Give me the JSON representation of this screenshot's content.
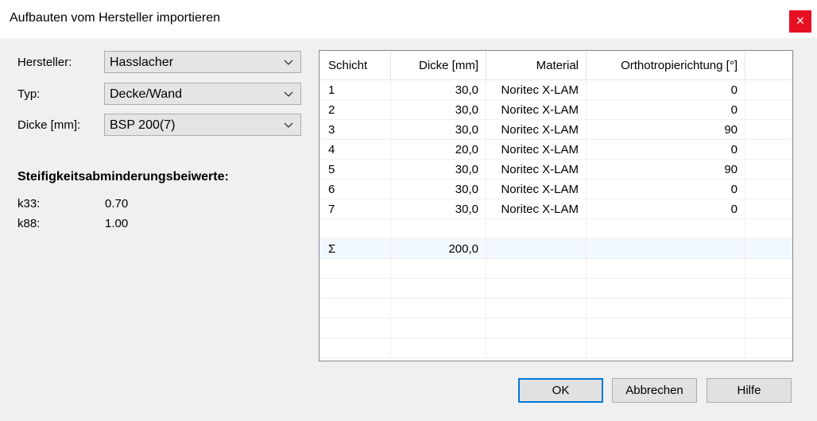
{
  "window": {
    "title": "Aufbauten vom Hersteller importieren",
    "close_glyph": "×"
  },
  "form": {
    "hersteller": {
      "label": "Hersteller:",
      "value": "Hasslacher"
    },
    "typ": {
      "label": "Typ:",
      "value": "Decke/Wand"
    },
    "dicke": {
      "label": "Dicke [mm]:",
      "value": "BSP 200(7)"
    }
  },
  "stiffness": {
    "title": "Steifigkeitsabminderungsbeiwerte:",
    "k33": {
      "label": "k33:",
      "value": "0.70"
    },
    "k88": {
      "label": "k88:",
      "value": "1.00"
    }
  },
  "table": {
    "headers": [
      "Schicht",
      "Dicke [mm]",
      "Material",
      "Orthotropierichtung [°]"
    ],
    "rows": [
      [
        "1",
        "30,0",
        "Noritec X-LAM",
        "0"
      ],
      [
        "2",
        "30,0",
        "Noritec X-LAM",
        "0"
      ],
      [
        "3",
        "30,0",
        "Noritec X-LAM",
        "90"
      ],
      [
        "4",
        "20,0",
        "Noritec X-LAM",
        "0"
      ],
      [
        "5",
        "30,0",
        "Noritec X-LAM",
        "90"
      ],
      [
        "6",
        "30,0",
        "Noritec X-LAM",
        "0"
      ],
      [
        "7",
        "30,0",
        "Noritec X-LAM",
        "0"
      ]
    ],
    "sum": {
      "symbol": "Σ",
      "dicke": "200,0"
    }
  },
  "buttons": {
    "ok": "OK",
    "cancel": "Abbrechen",
    "help": "Hilfe"
  },
  "colors": {
    "close": "#e81123",
    "default_button_border": "#0078d7",
    "sum_row": "#f1f8fe"
  }
}
